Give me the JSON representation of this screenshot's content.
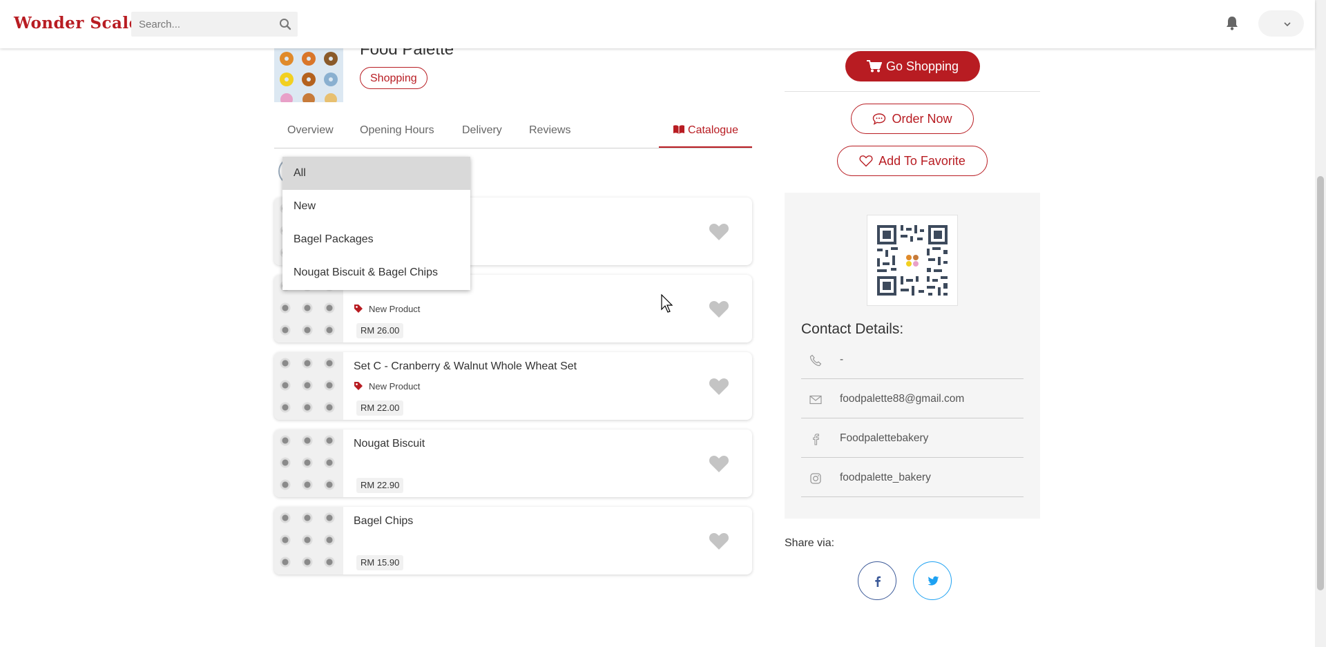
{
  "app": {
    "logo_text": "Wonder Scale"
  },
  "topbar": {
    "search_placeholder": "Search...",
    "icons": [
      "search-icon",
      "bell-icon",
      "chevron-down-icon"
    ]
  },
  "store": {
    "name": "Food Palette",
    "category": "Shopping"
  },
  "tabs": [
    {
      "label": "Overview"
    },
    {
      "label": "Opening Hours"
    },
    {
      "label": "Delivery"
    },
    {
      "label": "Reviews"
    },
    {
      "label": "Catalogue",
      "active": true,
      "icon": "book-icon"
    }
  ],
  "filter_dropdown": {
    "selected": "All",
    "options": [
      "All",
      "New",
      "Bagel Packages",
      "Nougat Biscuit & Bagel Chips"
    ]
  },
  "products": [
    {
      "name": "",
      "tag": "",
      "price": ""
    },
    {
      "name": "",
      "tag": "New Product",
      "price": "RM 26.00"
    },
    {
      "name": "Set C - Cranberry & Walnut Whole Wheat Set",
      "tag": "New Product",
      "price": "RM 22.00"
    },
    {
      "name": "Nougat Biscuit",
      "tag": "",
      "price": "RM 22.90"
    },
    {
      "name": "Bagel Chips",
      "tag": "",
      "price": "RM 15.90"
    }
  ],
  "actions": {
    "go_shopping": "Go Shopping",
    "order_now": "Order Now",
    "add_favorite": "Add To Favorite"
  },
  "contact": {
    "title": "Contact Details:",
    "phone": "-",
    "email": "foodpalette88@gmail.com",
    "facebook": "Foodpalettebakery",
    "instagram": "foodpalette_bakery"
  },
  "share": {
    "label": "Share via:",
    "facebook_color": "#3b5998",
    "twitter_color": "#1da1f2"
  },
  "colors": {
    "brand": "#b81c22",
    "panel_bg": "#f5f5f5"
  }
}
